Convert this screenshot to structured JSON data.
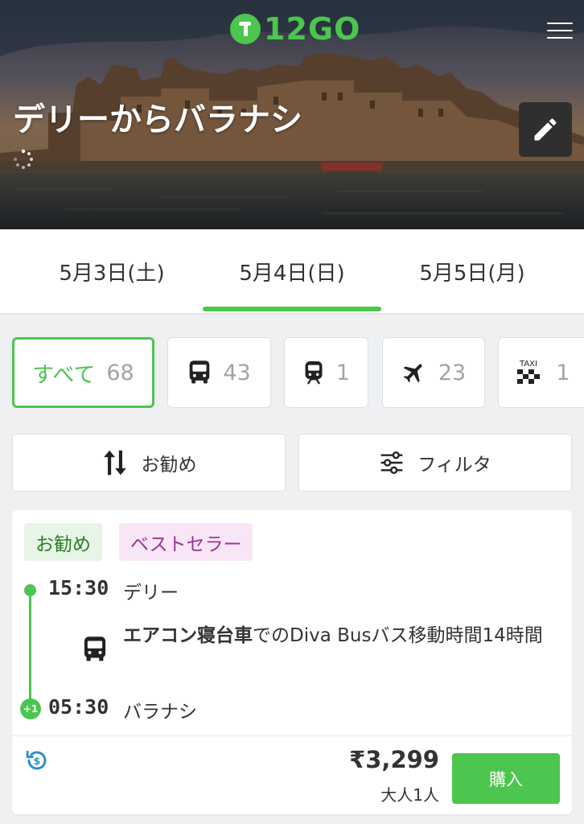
{
  "header": {
    "logo_text": "12GO",
    "route_title": "デリーからバラナシ",
    "brand_color": "#4cc64e",
    "menu_icon": "hamburger-menu-icon",
    "edit_icon": "pencil-icon"
  },
  "date_tabs": [
    {
      "label": "5月3日(土)"
    },
    {
      "label": "5月4日(日)",
      "selected": true
    },
    {
      "label": "5月5日(月)"
    }
  ],
  "transport_filter": {
    "all": {
      "label": "すべて",
      "count": "68"
    },
    "items": [
      {
        "icon": "bus-icon",
        "count": "43"
      },
      {
        "icon": "train-icon",
        "count": "1"
      },
      {
        "icon": "airplane-icon",
        "count": "23"
      },
      {
        "icon": "taxi-icon",
        "icon_text": "TAXI",
        "count": "1"
      }
    ]
  },
  "actions": {
    "sort_label": "お勧め",
    "filter_label": "フィルタ"
  },
  "result": {
    "badges": [
      "お勧め",
      "ベストセラー"
    ],
    "departure_time": "15:30",
    "departure_place": "デリー",
    "vehicle_type": "エアコン寝台車",
    "trip_info": "でのDiva Busバス移動時間14時間",
    "arrival_time": "05:30",
    "arrival_place": "バラナシ",
    "day_offset": "+1",
    "price": "₹3,299",
    "passengers": "大人1人",
    "buy_label": "購入"
  }
}
